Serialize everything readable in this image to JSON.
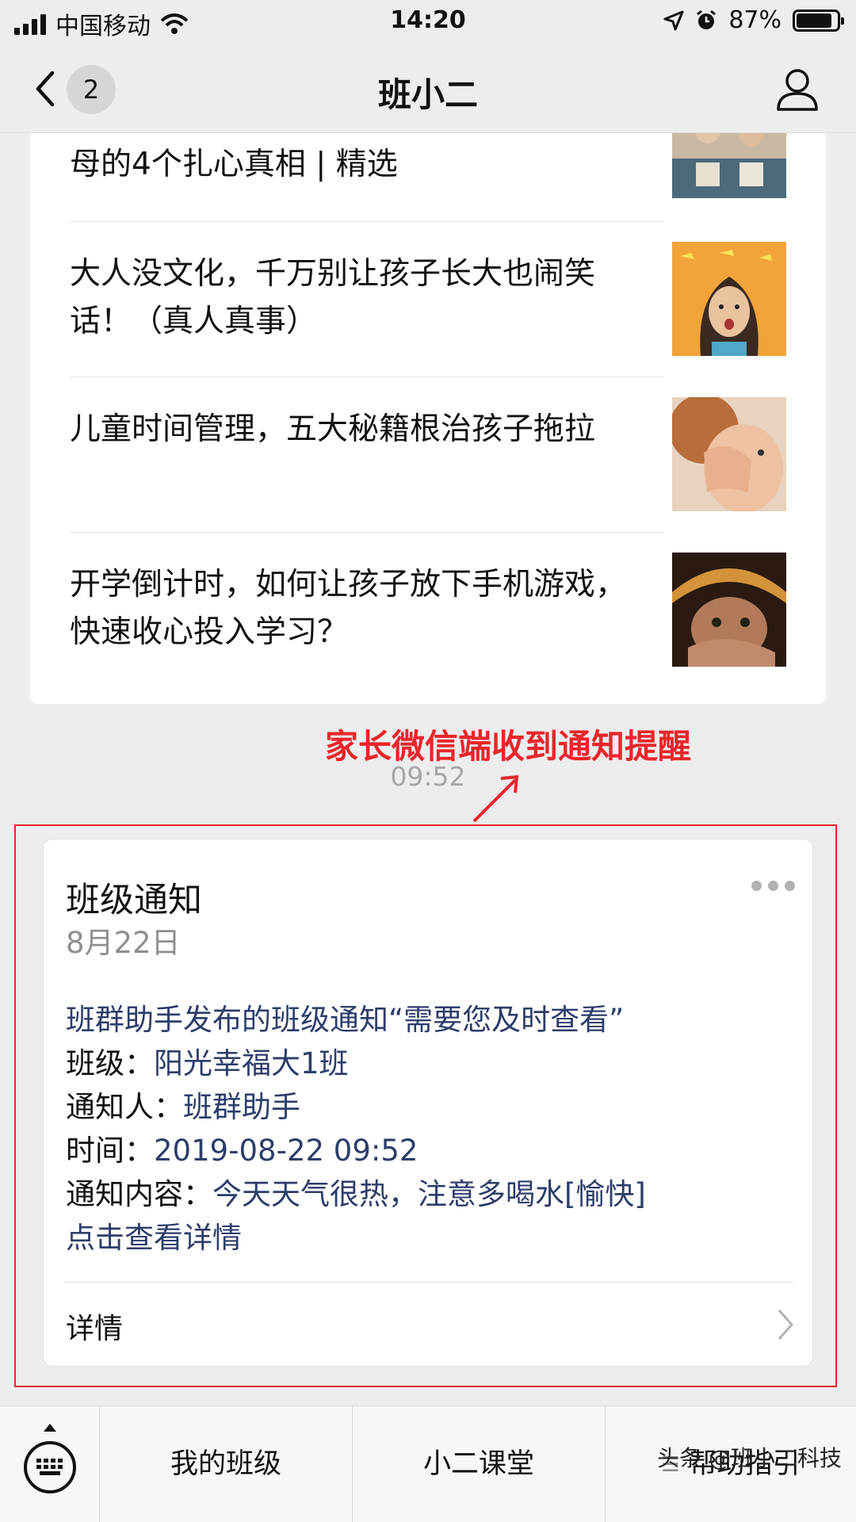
{
  "status_bar": {
    "carrier": "中国移动",
    "time": "14:20",
    "battery": "87%",
    "battery_level": 0.87,
    "icons": [
      "signal-icon",
      "wifi-icon",
      "location-icon",
      "alarm-icon",
      "battery-icon"
    ]
  },
  "nav": {
    "title": "班小二",
    "back_badge": "2"
  },
  "articles": [
    {
      "title": "母的4个扎心真相 | 精选",
      "thumb": "children-thumb"
    },
    {
      "title": "大人没文化，千万别让孩子长大也闹笑话！（真人真事）",
      "thumb": "girl-thumb"
    },
    {
      "title": "儿童时间管理，五大秘籍根治孩子拖拉",
      "thumb": "child-hand-thumb"
    },
    {
      "title": "开学倒计时，如何让孩子放下手机游戏，快速收心投入学习？",
      "thumb": "child-hat-thumb"
    }
  ],
  "annotation": "家长微信端收到通知提醒",
  "message_time": "09:52",
  "notice": {
    "title": "班级通知",
    "date": "8月22日",
    "headline": "班群助手发布的班级通知“需要您及时查看”",
    "class_label": "班级：",
    "class_value": "阳光幸福大1班",
    "notifier_label": "通知人：",
    "notifier_value": "班群助手",
    "time_label": "时间：",
    "time_value": "2019-08-22 09:52",
    "content_label": "通知内容：",
    "content_value": "今天天气很热，注意多喝水[愉快]",
    "link_text": "点击查看详情",
    "detail_label": "详情"
  },
  "bottom_menu": {
    "items": [
      "我的班级",
      "小二课堂",
      "帮助指引"
    ]
  },
  "watermark": "头条 @班小二科技",
  "colors": {
    "accent_red": "#e8262c",
    "link_blue": "#2d3d6b",
    "background": "#ededed"
  }
}
